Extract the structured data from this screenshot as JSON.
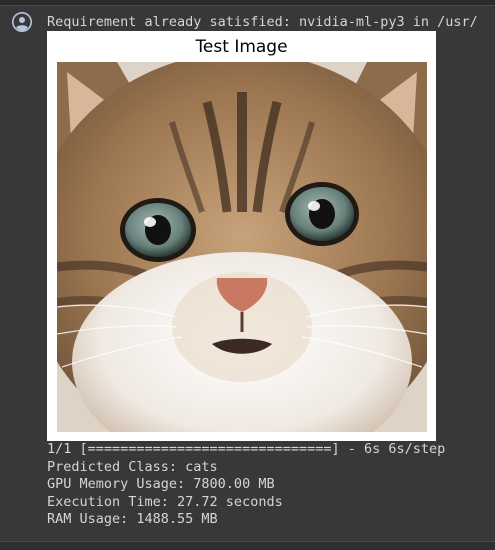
{
  "cell_output": {
    "output_icon": "robot-icon",
    "pip_line": "Requirement already satisfied: nvidia-ml-py3 in /usr/",
    "figure": {
      "title": "Test Image",
      "image_subject": "cat-kitten-face-photo"
    },
    "progress_line": "1/1 [==============================] - 6s 6s/step",
    "predicted_class": "Predicted Class: cats",
    "gpu_memory": "GPU Memory Usage: 7800.00 MB",
    "execution_time": "Execution Time: 27.72 seconds",
    "ram_usage": "RAM Usage: 1488.55 MB"
  },
  "colors": {
    "background": "#383838",
    "text": "#d5d5d5",
    "figure_bg": "#ffffff",
    "icon": "#b7c4d9"
  }
}
